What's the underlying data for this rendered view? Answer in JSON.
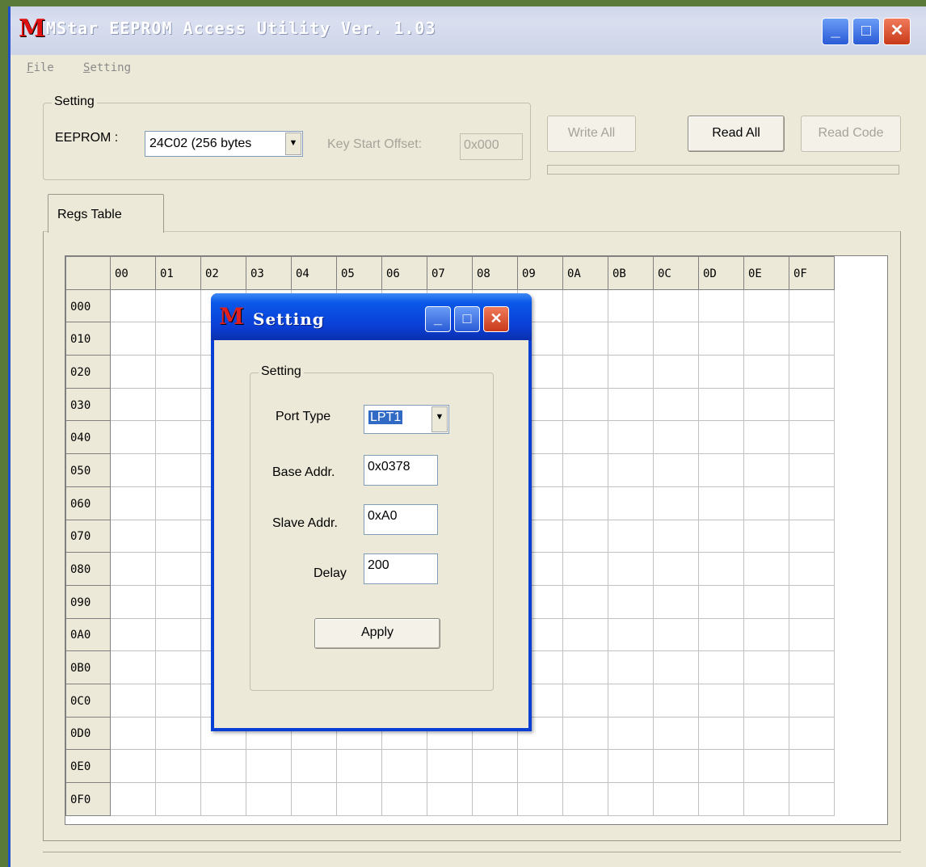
{
  "window": {
    "title": "MStar EEPROM Access Utility Ver. 1.03",
    "minimize": "_",
    "maximize": "□",
    "close": "✕"
  },
  "menu": {
    "file": "File",
    "setting": "Setting"
  },
  "setting_group": {
    "legend": "Setting",
    "eeprom_label": "EEPROM :",
    "eeprom_value": "24C02 (256 bytes",
    "key_offset_label": "Key Start Offset:",
    "key_offset_value": "0x000"
  },
  "buttons": {
    "write_all": "Write All",
    "read_all": "Read All",
    "read_code": "Read Code"
  },
  "tab": {
    "label": "Regs Table"
  },
  "grid": {
    "columns": [
      "00",
      "01",
      "02",
      "03",
      "04",
      "05",
      "06",
      "07",
      "08",
      "09",
      "0A",
      "0B",
      "0C",
      "0D",
      "0E",
      "0F"
    ],
    "rows": [
      "000",
      "010",
      "020",
      "030",
      "040",
      "050",
      "060",
      "070",
      "080",
      "090",
      "0A0",
      "0B0",
      "0C0",
      "0D0",
      "0E0",
      "0F0"
    ]
  },
  "dialog": {
    "title": "Setting",
    "group_legend": "Setting",
    "port_type_label": "Port Type",
    "port_type_value": "LPT1",
    "base_addr_label": "Base Addr.",
    "base_addr_value": "0x0378",
    "slave_addr_label": "Slave Addr.",
    "slave_addr_value": "0xA0",
    "delay_label": "Delay",
    "delay_value": "200",
    "apply_label": "Apply"
  },
  "icons": {
    "app_icon": "mstar-logo-icon",
    "dropdown_arrow": "▼"
  },
  "colors": {
    "title_active": "#0a3fd6",
    "close_button": "#d84a2a",
    "window_face": "#ece9d8",
    "selection": "#316ac5"
  }
}
